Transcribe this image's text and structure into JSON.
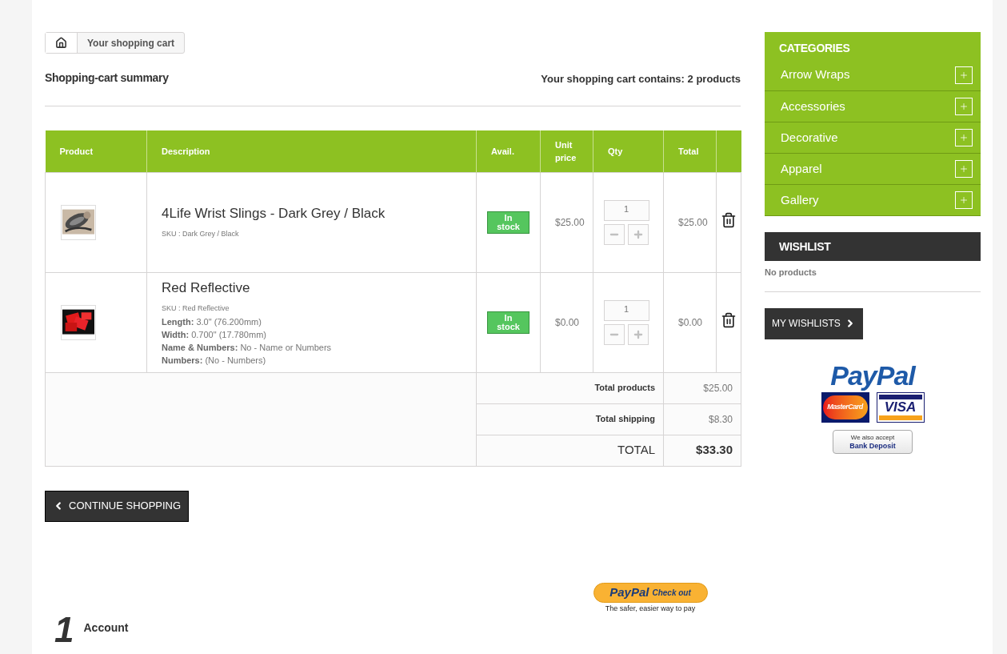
{
  "breadcrumb": {
    "items": [
      "Your shopping cart"
    ]
  },
  "summary": {
    "title": "Shopping-cart summary",
    "count_text": "Your shopping cart contains: 2 products"
  },
  "table": {
    "columns": [
      "Product",
      "Description",
      "Avail.",
      "Unit price",
      "Qty",
      "Total"
    ],
    "rows": [
      {
        "name": "4Life Wrist Slings - Dark Grey / Black",
        "sku": "SKU : Dark Grey / Black",
        "attributes": [],
        "availability": "In stock",
        "unit_price": "$25.00",
        "qty": "1",
        "total": "$25.00",
        "kind": "picture"
      },
      {
        "name": "Red Reflective",
        "sku": "SKU : Red Reflective",
        "attributes": [
          {
            "label": "Length:",
            "value": "3.0\" (76.200mm)"
          },
          {
            "label": "Width:",
            "value": "0.700\" (17.780mm)"
          },
          {
            "label": "Name & Numbers:",
            "value": "No - Name or Numbers"
          },
          {
            "label": "Numbers:",
            "value": "(No - Numbers)"
          }
        ],
        "availability": "In stock",
        "unit_price": "$0.00",
        "qty": "1",
        "total": "$0.00",
        "kind": "picture"
      }
    ],
    "totals": [
      {
        "label": "Total products",
        "value": "$25.00",
        "kind": "sub"
      },
      {
        "label": "Total shipping",
        "value": "$8.30",
        "kind": "sub"
      },
      {
        "label": "TOTAL",
        "value": "$33.30",
        "kind": "grand"
      }
    ]
  },
  "continue_button": "CONTINUE SHOPPING",
  "paypal_checkout": {
    "brand": "PayPal",
    "action": "Check out",
    "tagline": "The safer, easier way to pay"
  },
  "step": {
    "number": "1",
    "label": "Account"
  },
  "sidebar": {
    "categories": {
      "title": "CATEGORIES",
      "items": [
        {
          "label": "Arrow Wraps",
          "expanded": false
        },
        {
          "label": "Accessories",
          "expanded": false
        },
        {
          "label": "Decorative",
          "expanded": false
        },
        {
          "label": "Apparel",
          "expanded": false
        },
        {
          "label": "Gallery",
          "expanded": false
        }
      ]
    },
    "wishlist": {
      "title": "WISHLIST",
      "empty_text": "No products",
      "button": "MY WISHLISTS"
    },
    "payments": {
      "paypal": "PayPal",
      "mastercard": "MasterCard",
      "visa": "VISA",
      "bank_note": "We also accept",
      "bank_label": "Bank Deposit"
    }
  }
}
